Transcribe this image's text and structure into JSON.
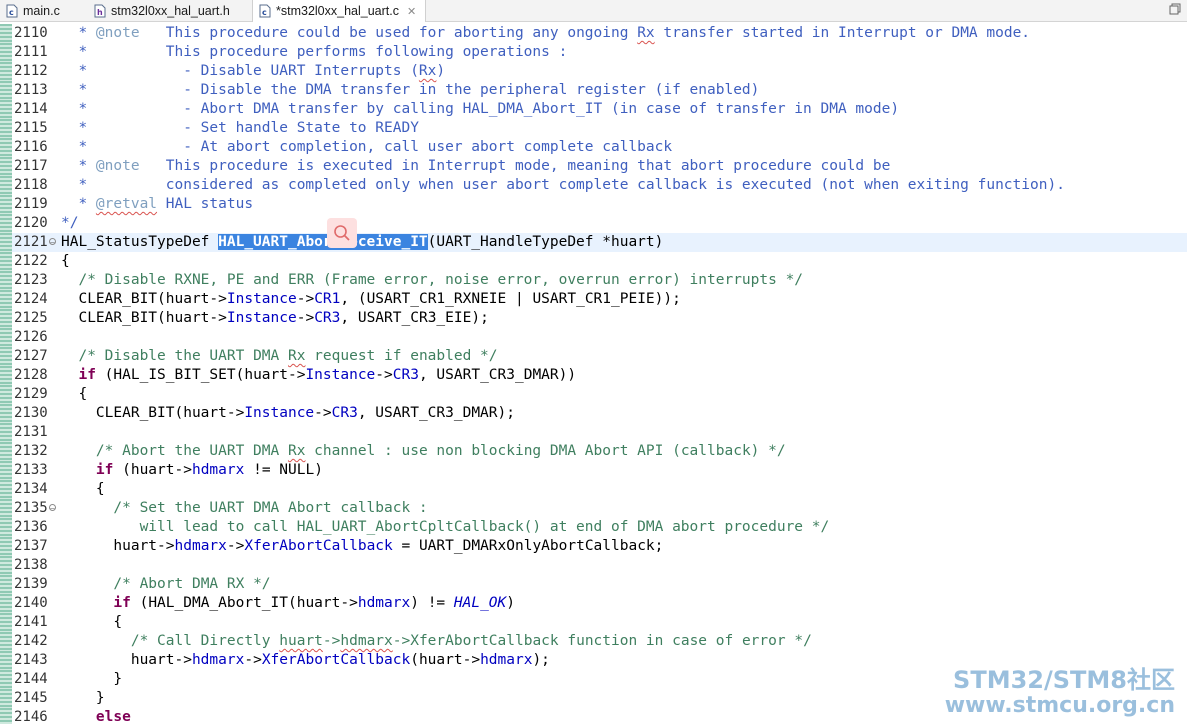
{
  "tabs": [
    {
      "label": "main.c",
      "icon": "c-file-icon",
      "active": false
    },
    {
      "label": "stm32l0xx_hal_uart.h",
      "icon": "h-file-icon",
      "active": false
    },
    {
      "label": "*stm32l0xx_hal_uart.c",
      "icon": "c-file-icon",
      "active": true,
      "close": "✕"
    }
  ],
  "colors": {
    "keyword": "#7f0055",
    "comment": "#3f7f5f",
    "doc": "#3f5fbf",
    "field": "#0000c0",
    "selection": "#3b84e0"
  },
  "lines": [
    {
      "n": "2110",
      "t": "  * @note   This procedure could be used for aborting any ongoing Rx transfer started in Interrupt or DMA mode."
    },
    {
      "n": "2111",
      "t": "  *         This procedure performs following operations :"
    },
    {
      "n": "2112",
      "t": "  *           - Disable UART Interrupts (Rx)"
    },
    {
      "n": "2113",
      "t": "  *           - Disable the DMA transfer in the peripheral register (if enabled)"
    },
    {
      "n": "2114",
      "t": "  *           - Abort DMA transfer by calling HAL_DMA_Abort_IT (in case of transfer in DMA mode)"
    },
    {
      "n": "2115",
      "t": "  *           - Set handle State to READY"
    },
    {
      "n": "2116",
      "t": "  *           - At abort completion, call user abort complete callback"
    },
    {
      "n": "2117",
      "t": "  * @note   This procedure is executed in Interrupt mode, meaning that abort procedure could be"
    },
    {
      "n": "2118",
      "t": "  *         considered as completed only when user abort complete callback is executed (not when exiting function)."
    },
    {
      "n": "2119",
      "t": "  * @retval HAL status"
    },
    {
      "n": "2120",
      "t": "*/"
    },
    {
      "n": "2121",
      "t": "HAL_StatusTypeDef HAL_UART_AbortReceive_IT(UART_HandleTypeDef *huart)"
    },
    {
      "n": "2122",
      "t": "{"
    },
    {
      "n": "2123",
      "t": "  /* Disable RXNE, PE and ERR (Frame error, noise error, overrun error) interrupts */"
    },
    {
      "n": "2124",
      "t": "  CLEAR_BIT(huart->Instance->CR1, (USART_CR1_RXNEIE | USART_CR1_PEIE));"
    },
    {
      "n": "2125",
      "t": "  CLEAR_BIT(huart->Instance->CR3, USART_CR3_EIE);"
    },
    {
      "n": "2126",
      "t": ""
    },
    {
      "n": "2127",
      "t": "  /* Disable the UART DMA Rx request if enabled */"
    },
    {
      "n": "2128",
      "t": "  if (HAL_IS_BIT_SET(huart->Instance->CR3, USART_CR3_DMAR))"
    },
    {
      "n": "2129",
      "t": "  {"
    },
    {
      "n": "2130",
      "t": "    CLEAR_BIT(huart->Instance->CR3, USART_CR3_DMAR);"
    },
    {
      "n": "2131",
      "t": ""
    },
    {
      "n": "2132",
      "t": "    /* Abort the UART DMA Rx channel : use non blocking DMA Abort API (callback) */"
    },
    {
      "n": "2133",
      "t": "    if (huart->hdmarx != NULL)"
    },
    {
      "n": "2134",
      "t": "    {"
    },
    {
      "n": "2135",
      "t": "      /* Set the UART DMA Abort callback :"
    },
    {
      "n": "2136",
      "t": "         will lead to call HAL_UART_AbortCpltCallback() at end of DMA abort procedure */"
    },
    {
      "n": "2137",
      "t": "      huart->hdmarx->XferAbortCallback = UART_DMARxOnlyAbortCallback;"
    },
    {
      "n": "2138",
      "t": ""
    },
    {
      "n": "2139",
      "t": "      /* Abort DMA RX */"
    },
    {
      "n": "2140",
      "t": "      if (HAL_DMA_Abort_IT(huart->hdmarx) != HAL_OK)"
    },
    {
      "n": "2141",
      "t": "      {"
    },
    {
      "n": "2142",
      "t": "        /* Call Directly huart->hdmarx->XferAbortCallback function in case of error */"
    },
    {
      "n": "2143",
      "t": "        huart->hdmarx->XferAbortCallback(huart->hdmarx);"
    },
    {
      "n": "2144",
      "t": "      }"
    },
    {
      "n": "2145",
      "t": "    }"
    },
    {
      "n": "2146",
      "t": "    else"
    }
  ],
  "watermark": {
    "line1": "STM32/STM8社区",
    "line2": "www.stmcu.org.cn"
  }
}
